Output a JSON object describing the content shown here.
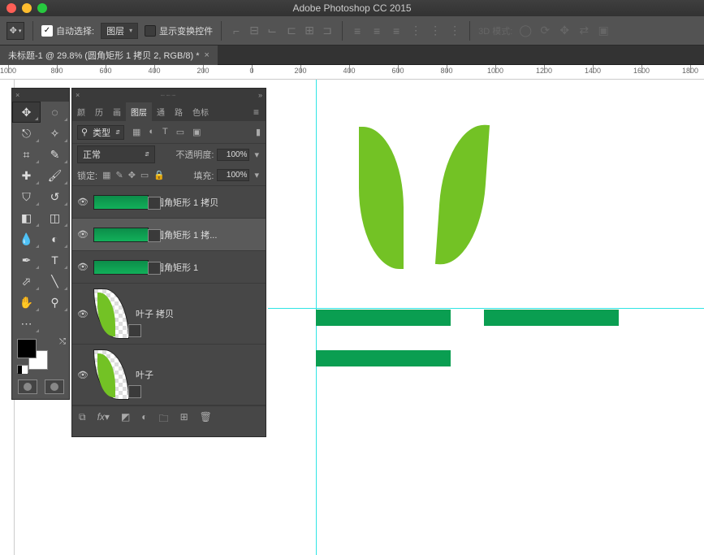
{
  "app": {
    "title": "Adobe Photoshop CC 2015"
  },
  "optsbar": {
    "auto_select_label": "自动选择:",
    "auto_select_checked": "✓",
    "layer_dropdown": "图层",
    "show_transform_label": "显示变换控件",
    "show_transform_checked": "",
    "mode3d_label": "3D 模式:"
  },
  "doc": {
    "tab_title": "未标题-1 @ 29.8% (圆角矩形 1 拷贝 2, RGB/8) *"
  },
  "ruler": {
    "marks": [
      "1000",
      "800",
      "600",
      "400",
      "200",
      "0",
      "200",
      "400",
      "600",
      "800",
      "1000",
      "1200",
      "1400",
      "1600",
      "1800"
    ]
  },
  "panel": {
    "tabs": [
      "颜",
      "历",
      "画",
      "图层",
      "通",
      "路",
      "色标"
    ],
    "active_tab": 3,
    "filter_type": "类型",
    "blend_mode": "正常",
    "opacity_label": "不透明度:",
    "opacity_value": "100%",
    "lock_label": "锁定:",
    "fill_label": "填充:",
    "fill_value": "100%"
  },
  "layers": [
    {
      "name": "圆角矩形 1 拷贝",
      "kind": "shape",
      "selected": false
    },
    {
      "name": "圆角矩形 1 拷...",
      "kind": "shape",
      "selected": true
    },
    {
      "name": "圆角矩形 1",
      "kind": "shape",
      "selected": false
    },
    {
      "name": "叶子 拷贝",
      "kind": "leaf",
      "selected": false
    },
    {
      "name": "叶子",
      "kind": "leaf",
      "selected": false
    }
  ],
  "tools": [
    [
      "move",
      "marquee-ellipse"
    ],
    [
      "lasso",
      "wand"
    ],
    [
      "crop",
      "eyedropper"
    ],
    [
      "spot-heal",
      "brush"
    ],
    [
      "stamp",
      "history-brush"
    ],
    [
      "eraser",
      "gradient"
    ],
    [
      "blur",
      "dodge"
    ],
    [
      "pen",
      "type"
    ],
    [
      "path-select",
      "line"
    ],
    [
      "hand",
      "zoom"
    ],
    [
      "more",
      ""
    ]
  ]
}
